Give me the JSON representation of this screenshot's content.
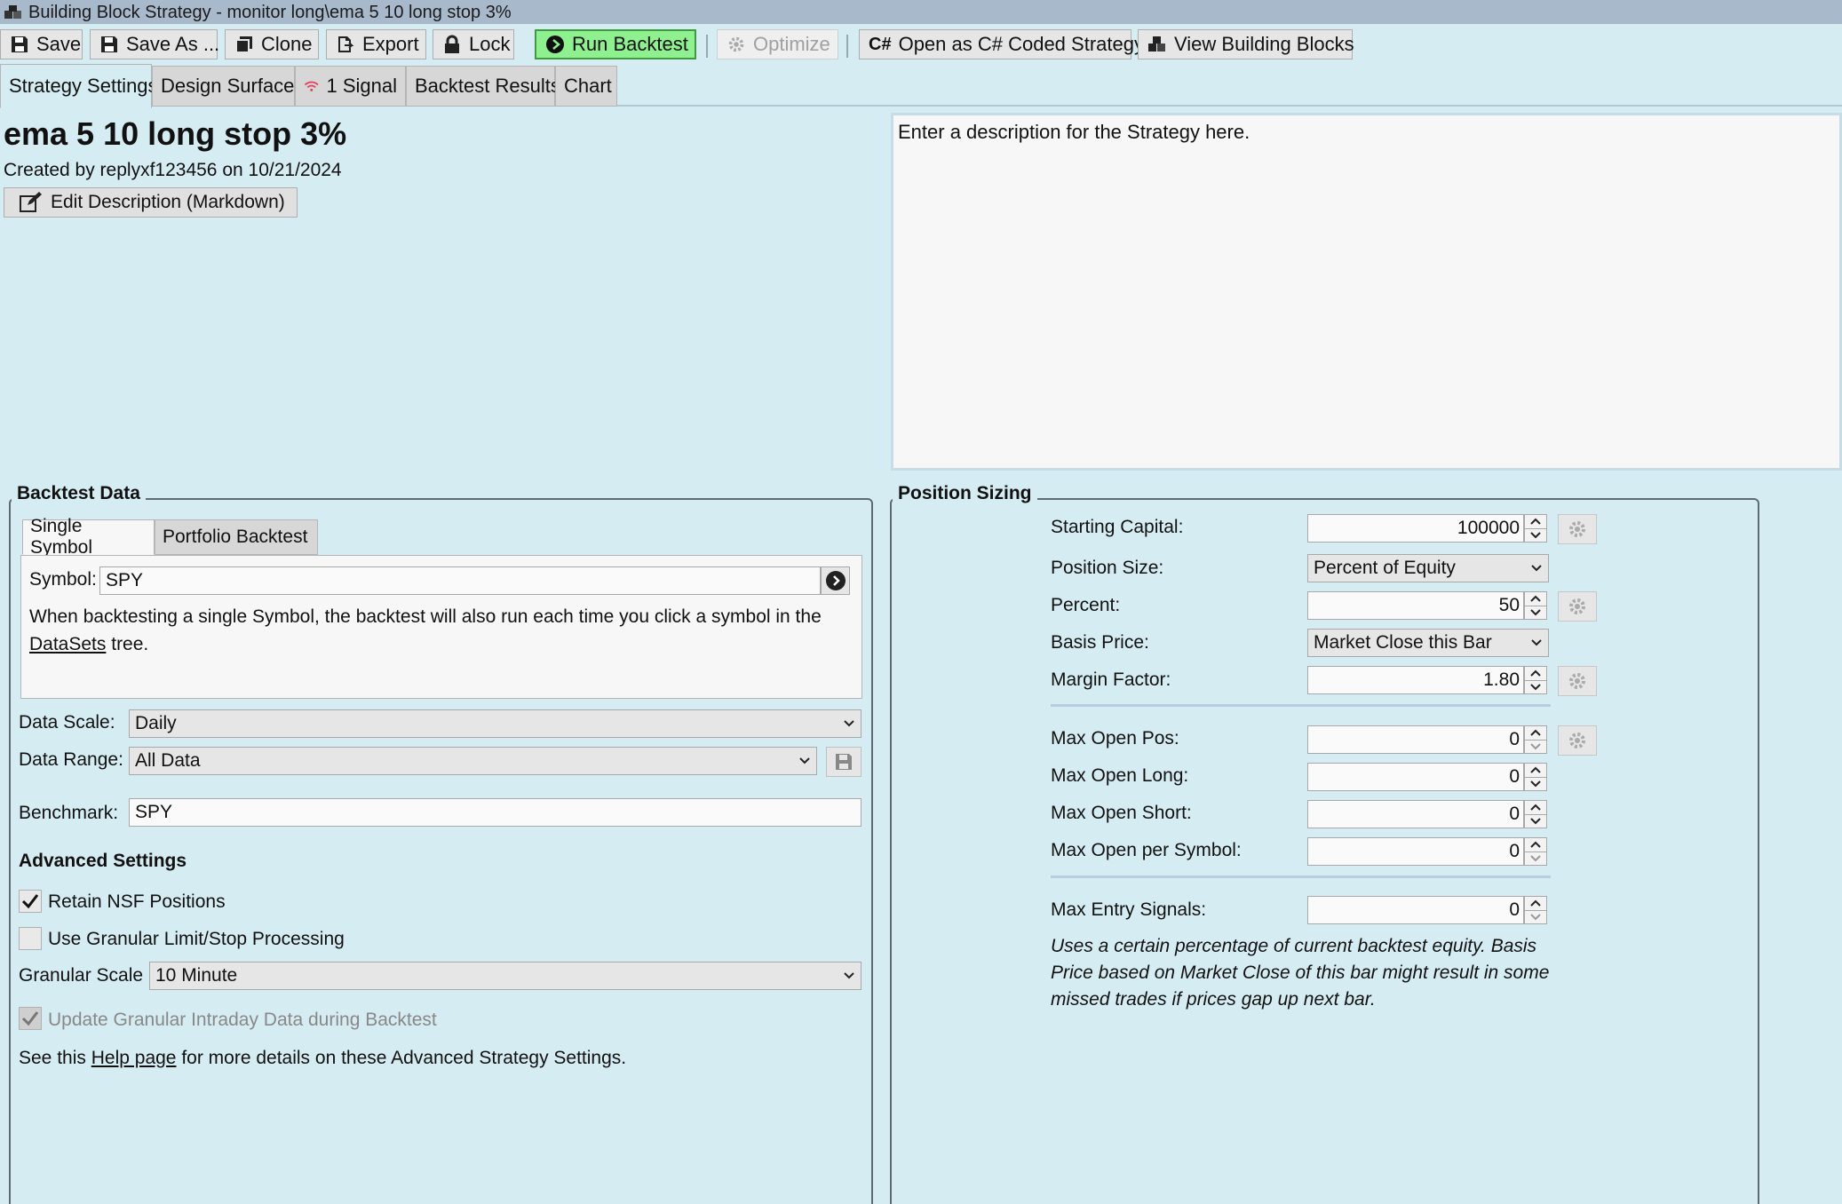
{
  "window": {
    "title": "Building Block Strategy - monitor long\\ema 5 10 long stop 3%"
  },
  "toolbar": {
    "save": "Save",
    "save_as": "Save As ...",
    "clone": "Clone",
    "export": "Export",
    "lock": "Lock",
    "run_backtest": "Run Backtest",
    "optimize": "Optimize",
    "open_csharp": "Open as C# Coded Strategy",
    "view_blocks": "View Building Blocks"
  },
  "tabs": {
    "strategy_settings": "Strategy Settings",
    "design_surface": "Design Surface",
    "signal": "1 Signal",
    "backtest_results": "Backtest Results",
    "chart": "Chart"
  },
  "strategy": {
    "name": "ema 5 10 long stop 3%",
    "created_by": "Created by replyxf123456 on 10/21/2024",
    "edit_description_label": "Edit Description (Markdown)",
    "description": "Enter a description for the Strategy here."
  },
  "backtest_data": {
    "group_title": "Backtest Data",
    "tab_single": "Single Symbol",
    "tab_portfolio": "Portfolio Backtest",
    "symbol_label": "Symbol:",
    "symbol_value": "SPY",
    "help_text_1": "When backtesting a single Symbol, the backtest will also run each time you click a symbol in the",
    "help_link": "DataSets",
    "help_text_2": "tree.",
    "data_scale_label": "Data Scale:",
    "data_scale_value": "Daily",
    "data_range_label": "Data Range:",
    "data_range_value": "All Data",
    "benchmark_label": "Benchmark:",
    "benchmark_value": "SPY"
  },
  "advanced": {
    "title": "Advanced Settings",
    "retain_nsf": "Retain NSF Positions",
    "retain_nsf_checked": true,
    "granular_limit": "Use Granular Limit/Stop Processing",
    "granular_limit_checked": false,
    "granular_scale_label": "Granular Scale",
    "granular_scale_value": "10 Minute",
    "update_granular": "Update Granular Intraday Data during Backtest",
    "update_granular_checked": true,
    "see_this": "See this",
    "help_page": "Help page",
    "see_rest": "for more details on these Advanced Strategy Settings."
  },
  "position_sizing": {
    "group_title": "Position Sizing",
    "starting_capital_label": "Starting Capital:",
    "starting_capital_value": "100000",
    "position_size_label": "Position Size:",
    "position_size_value": "Percent of Equity",
    "percent_label": "Percent:",
    "percent_value": "50",
    "basis_price_label": "Basis Price:",
    "basis_price_value": "Market Close this Bar",
    "margin_factor_label": "Margin Factor:",
    "margin_factor_value": "1.80",
    "max_open_pos_label": "Max Open Pos:",
    "max_open_pos_value": "0",
    "max_open_long_label": "Max Open Long:",
    "max_open_long_value": "0",
    "max_open_short_label": "Max Open Short:",
    "max_open_short_value": "0",
    "max_open_per_symbol_label": "Max Open per Symbol:",
    "max_open_per_symbol_value": "0",
    "max_entry_signals_label": "Max Entry Signals:",
    "max_entry_signals_value": "0",
    "note_1": "Uses a certain percentage of current backtest equity. Basis",
    "note_2": "Price based on Market Close of this bar might result in some",
    "note_3": "missed trades if prices gap up next bar."
  },
  "colors": {
    "background": "#d6ecf3",
    "run_backtest": "#8ff08f",
    "signal_icon": "#e0405a"
  }
}
